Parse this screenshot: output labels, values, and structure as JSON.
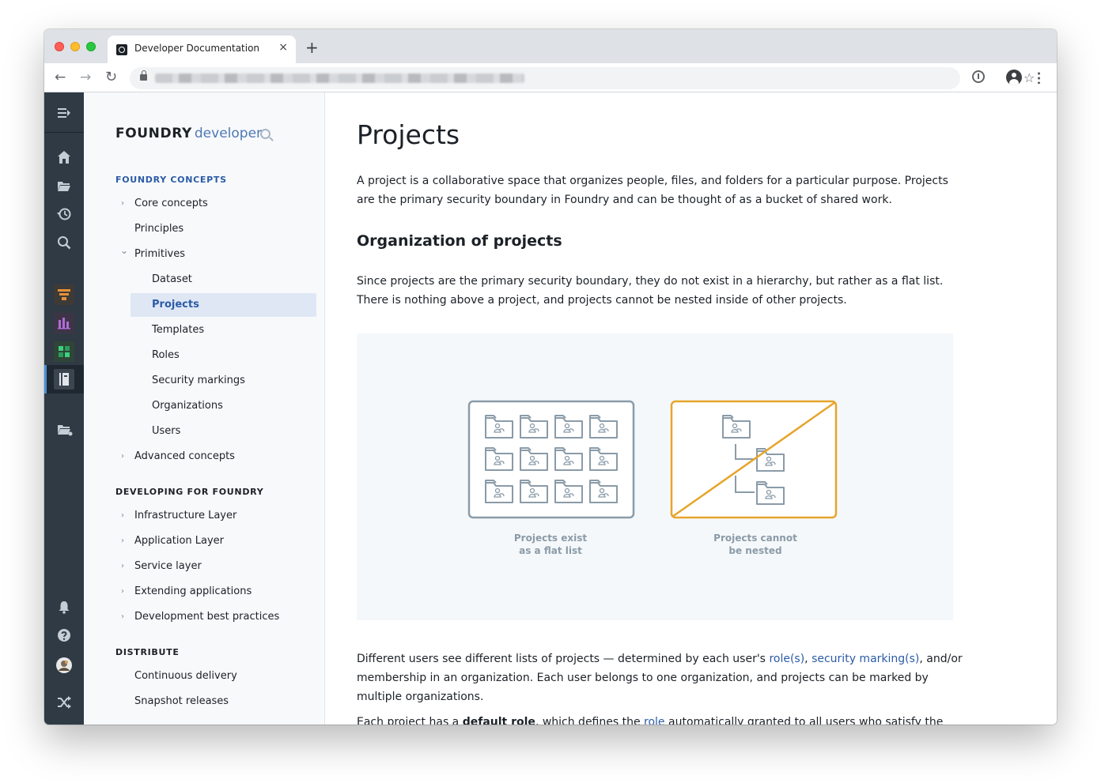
{
  "browser": {
    "tab_title": "Developer Documentation",
    "tab_close": "×",
    "new_tab": "+",
    "back": "←",
    "forward": "→",
    "reload": "↻",
    "bookmark": "☆"
  },
  "sidebar": {
    "brand_primary": "FOUNDRY",
    "brand_secondary": "developer",
    "sections": [
      {
        "title": "FOUNDRY CONCEPTS",
        "items": [
          {
            "label": "Core concepts",
            "chevron": "›"
          },
          {
            "label": "Principles"
          },
          {
            "label": "Primitives",
            "chevron": "⌄"
          },
          {
            "label": "Dataset"
          },
          {
            "label": "Projects",
            "selected": true
          },
          {
            "label": "Templates"
          },
          {
            "label": "Roles"
          },
          {
            "label": "Security markings"
          },
          {
            "label": "Organizations"
          },
          {
            "label": "Users"
          },
          {
            "label": "Advanced concepts",
            "chevron": "›"
          }
        ]
      },
      {
        "title": "DEVELOPING FOR FOUNDRY",
        "items": [
          {
            "label": "Infrastructure Layer",
            "chevron": "›"
          },
          {
            "label": "Application Layer",
            "chevron": "›"
          },
          {
            "label": "Service layer",
            "chevron": "›"
          },
          {
            "label": "Extending applications",
            "chevron": "›"
          },
          {
            "label": "Development best practices",
            "chevron": "›"
          }
        ]
      },
      {
        "title": "DISTRIBUTE",
        "items": [
          {
            "label": "Continuous delivery"
          },
          {
            "label": "Snapshot releases"
          }
        ]
      }
    ]
  },
  "iconbar": {
    "icons": [
      "sidebar-toggle-icon",
      "home-icon",
      "folder-icon",
      "history-icon",
      "search-icon",
      "funnel-app-icon",
      "chart-app-icon",
      "grid-app-icon",
      "book-app-icon",
      "folder-share-icon",
      "bell-icon",
      "help-icon",
      "avatar",
      "shuffle-icon"
    ],
    "accent_colors": {
      "funnel": "#e5913a",
      "chart": "#9b59b6",
      "grid": "#27ae60"
    }
  },
  "article": {
    "title": "Projects",
    "intro": "A project is a collaborative space that organizes people, files, and folders for a particular purpose. Projects are the primary security boundary in Foundry and can be thought of as a bucket of shared work.",
    "h2": "Organization of projects",
    "para2": "Since projects are the primary security boundary, they do not exist in a hierarchy, but rather as a flat list. There is nothing above a project, and projects cannot be nested inside of other projects.",
    "figure": {
      "caption_left_1": "Projects exist",
      "caption_left_2": "as a flat list",
      "caption_right_1": "Projects cannot",
      "caption_right_2": "be nested",
      "accent_color": "#e6a52c",
      "folder_color": "#8a9ba8"
    },
    "para3": {
      "part1": "Different users see different lists of projects — determined by each user's ",
      "link1": "role(s)",
      "sep": ", ",
      "link2": "security marking(s)",
      "part2": ", and/or membership in an organization. Each user belongs to one organization, and projects can be marked by multiple organizations."
    },
    "para4": {
      "part1": "Each project has a ",
      "bold": "default role",
      "part2": ", which defines the ",
      "link": "role",
      "part3": " automatically granted to all users who satisfy the"
    }
  }
}
